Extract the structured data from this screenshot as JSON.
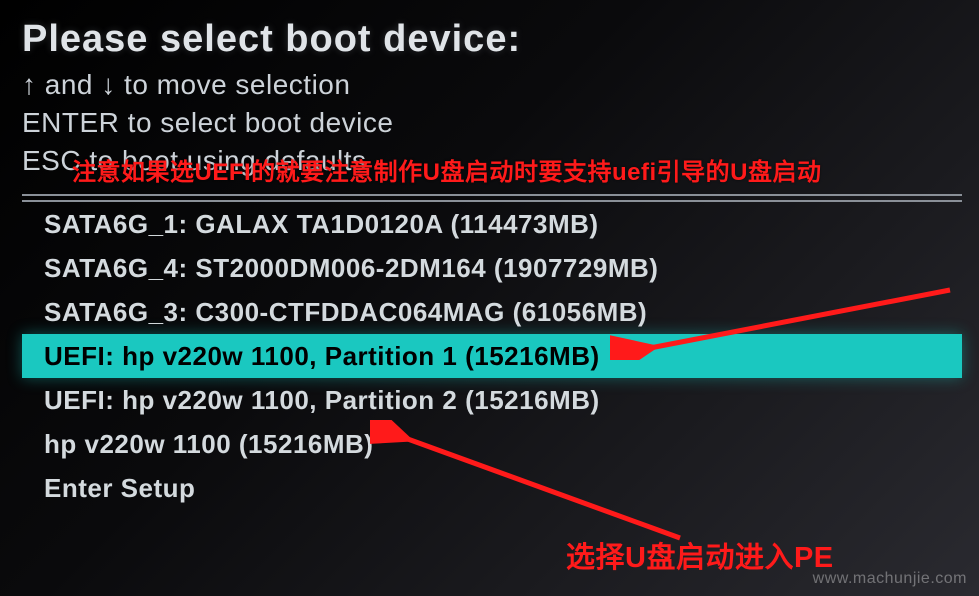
{
  "title": "Please select boot device:",
  "instructions": [
    "↑ and ↓ to move selection",
    "ENTER to select boot device",
    "ESC to boot using defaults"
  ],
  "annotations": {
    "top": "注意如果选UEFI的就要注意制作U盘启动时要支持uefi引导的U盘启动",
    "bottom": "选择U盘启动进入PE"
  },
  "boot_items": [
    {
      "label": "SATA6G_1: GALAX TA1D0120A  (114473MB)",
      "selected": false
    },
    {
      "label": "SATA6G_4: ST2000DM006-2DM164  (1907729MB)",
      "selected": false
    },
    {
      "label": "SATA6G_3: C300-CTFDDAC064MAG  (61056MB)",
      "selected": false
    },
    {
      "label": "UEFI: hp v220w 1100, Partition 1 (15216MB)",
      "selected": true
    },
    {
      "label": "UEFI: hp v220w 1100, Partition 2 (15216MB)",
      "selected": false
    },
    {
      "label": "hp v220w 1100  (15216MB)",
      "selected": false
    },
    {
      "label": "Enter Setup",
      "selected": false
    }
  ],
  "watermark": "www.machunjie.com"
}
